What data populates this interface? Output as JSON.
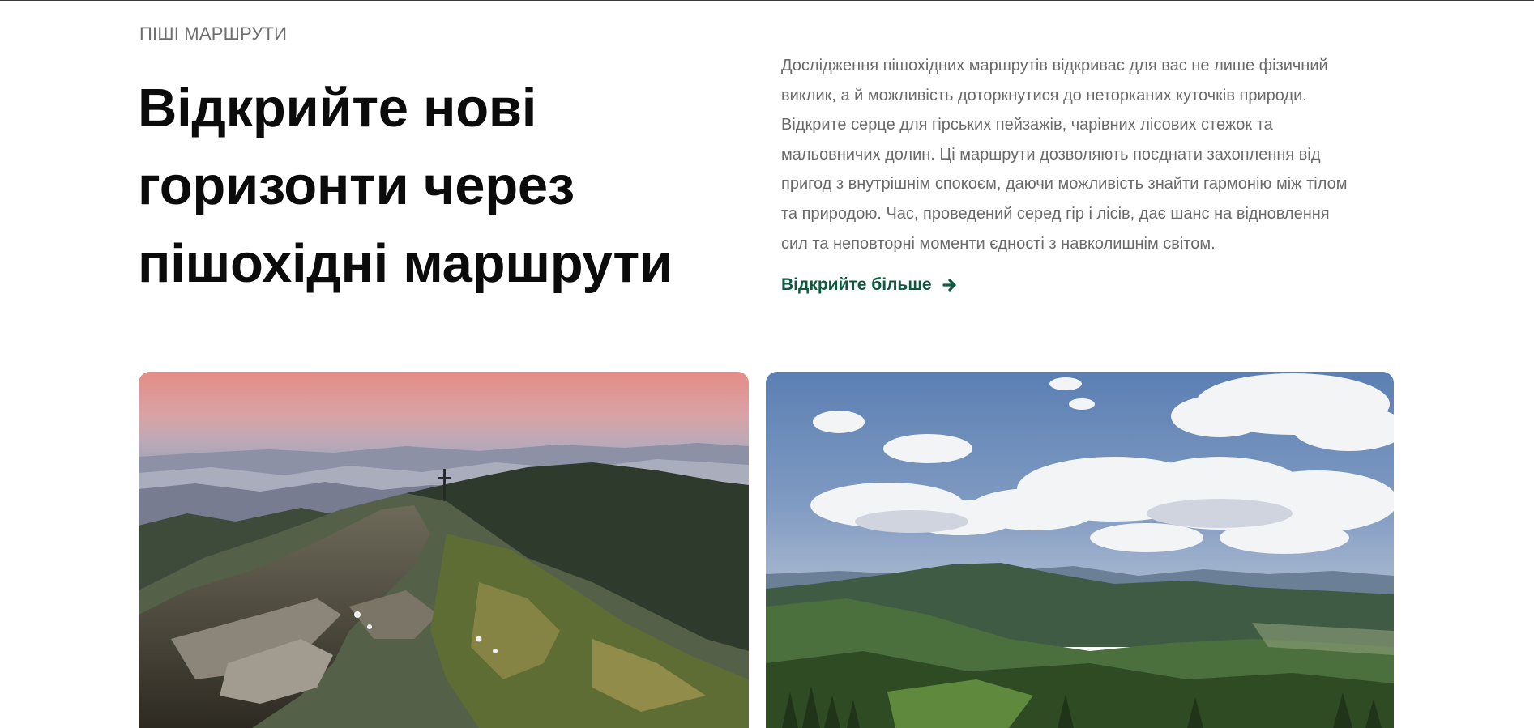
{
  "section": {
    "eyebrow": "ПІШІ МАРШРУТИ",
    "headline_lines": [
      "Відкрийте нові",
      "горизонти через",
      "пішохідні маршрути"
    ],
    "description_lines": [
      "Дослідження пішохідних маршрутів відкриває для вас не лише фізичний",
      "виклик, а й можливість доторкнутися до неторканих куточків природи.",
      "Відкрите серце для гірських пейзажів, чарівних лісових стежок та",
      "мальовничих долин. Ці маршрути дозволяють поєднати захоплення від",
      "пригод з внутрішнім спокоєм, даючи можливість знайти гармонію між тілом",
      "та природою. Час, проведений серед гір і лісів, дає шанс на відновлення",
      "сил та неповторні моменти єдності з навколишнім світом."
    ],
    "cta_label": "Відкрийте більше",
    "cta_icon": "arrow-right-icon"
  },
  "gallery": {
    "left_photo_subject": "mountain-sunrise-photo",
    "right_photo_subject": "forest-valley-photo"
  },
  "colors": {
    "accent": "#0d5a3d",
    "eyebrow": "#6f6f6f",
    "body_text": "#6a6a6a",
    "heading": "#0b0b0b"
  }
}
